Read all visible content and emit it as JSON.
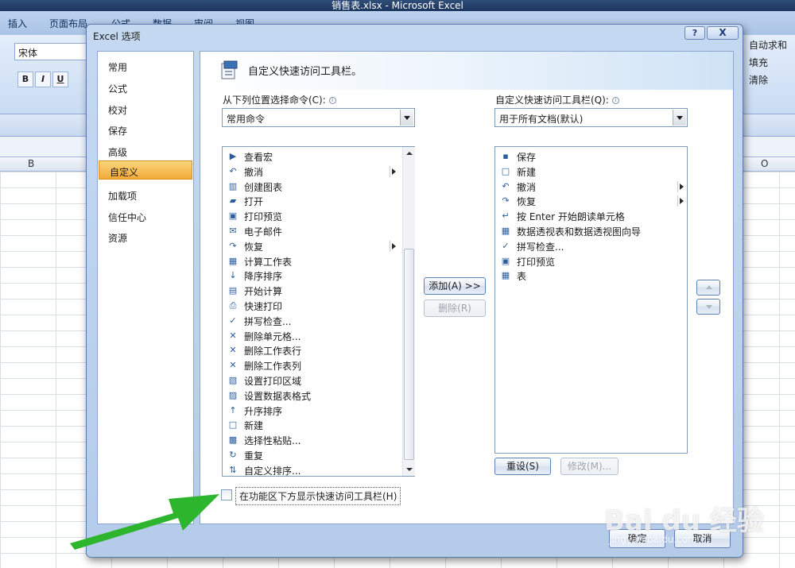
{
  "excel": {
    "title": "销售表.xlsx - Microsoft Excel",
    "tabs": [
      "插入",
      "页面布局",
      "公式",
      "数据",
      "审阅",
      "视图"
    ],
    "font_name": "宋体",
    "right_commands": [
      "自动求和",
      "填充",
      "清除"
    ],
    "columns": [
      "B",
      "O"
    ]
  },
  "dialog": {
    "title": "Excel 选项",
    "help_label": "?",
    "close_label": "X",
    "nav": [
      "常用",
      "公式",
      "校对",
      "保存",
      "高级",
      "自定义",
      "加载项",
      "信任中心",
      "资源"
    ],
    "selected_nav": "自定义",
    "header": "自定义快速访问工具栏。",
    "left_label": "从下列位置选择命令(C):",
    "left_combo": "常用命令",
    "right_label": "自定义快速访问工具栏(Q):",
    "right_combo": "用于所有文档(默认)",
    "commands": [
      {
        "label": "查看宏",
        "icon": "play-icon",
        "glyph": "▶",
        "submenu": false
      },
      {
        "label": "撤消",
        "icon": "undo-icon",
        "glyph": "↶",
        "submenu": true
      },
      {
        "label": "创建图表",
        "icon": "chart-icon",
        "glyph": "▥",
        "submenu": false
      },
      {
        "label": "打开",
        "icon": "folder-icon",
        "glyph": "▰",
        "submenu": false
      },
      {
        "label": "打印预览",
        "icon": "print-preview-icon",
        "glyph": "▣",
        "submenu": false
      },
      {
        "label": "电子邮件",
        "icon": "email-icon",
        "glyph": "✉",
        "submenu": false
      },
      {
        "label": "恢复",
        "icon": "redo-icon",
        "glyph": "↷",
        "submenu": true
      },
      {
        "label": "计算工作表",
        "icon": "calculator-icon",
        "glyph": "▦",
        "submenu": false
      },
      {
        "label": "降序排序",
        "icon": "sort-desc-icon",
        "glyph": "↓",
        "submenu": false
      },
      {
        "label": "开始计算",
        "icon": "calculate-icon",
        "glyph": "▤",
        "submenu": false
      },
      {
        "label": "快速打印",
        "icon": "printer-icon",
        "glyph": "⎙",
        "submenu": false
      },
      {
        "label": "拼写检查...",
        "icon": "spell-check-icon",
        "glyph": "✓",
        "submenu": false
      },
      {
        "label": "删除单元格...",
        "icon": "delete-cells-icon",
        "glyph": "✕",
        "submenu": false
      },
      {
        "label": "删除工作表行",
        "icon": "delete-rows-icon",
        "glyph": "✕",
        "submenu": false
      },
      {
        "label": "删除工作表列",
        "icon": "delete-columns-icon",
        "glyph": "✕",
        "submenu": false
      },
      {
        "label": "设置打印区域",
        "icon": "print-area-icon",
        "glyph": "▧",
        "submenu": false
      },
      {
        "label": "设置数据表格式",
        "icon": "table-format-icon",
        "glyph": "▨",
        "submenu": false
      },
      {
        "label": "升序排序",
        "icon": "sort-asc-icon",
        "glyph": "↑",
        "submenu": false
      },
      {
        "label": "新建",
        "icon": "new-document-icon",
        "glyph": "□",
        "submenu": false
      },
      {
        "label": "选择性粘贴...",
        "icon": "paste-special-icon",
        "glyph": "▩",
        "submenu": false
      },
      {
        "label": "重复",
        "icon": "repeat-icon",
        "glyph": "↻",
        "submenu": false
      },
      {
        "label": "自定义排序...",
        "icon": "custom-sort-icon",
        "glyph": "⇅",
        "submenu": false
      }
    ],
    "toolbar_items": [
      {
        "label": "保存",
        "icon": "save-icon",
        "glyph": "▪",
        "submenu": false
      },
      {
        "label": "新建",
        "icon": "new-document-icon",
        "glyph": "□",
        "submenu": false
      },
      {
        "label": "撤消",
        "icon": "undo-icon",
        "glyph": "↶",
        "submenu": true
      },
      {
        "label": "恢复",
        "icon": "redo-icon",
        "glyph": "↷",
        "submenu": true
      },
      {
        "label": "按 Enter 开始朗读单元格",
        "icon": "speak-cells-icon",
        "glyph": "↵",
        "submenu": false
      },
      {
        "label": "数据透视表和数据透视图向导",
        "icon": "pivot-wizard-icon",
        "glyph": "▦",
        "submenu": false
      },
      {
        "label": "拼写检查...",
        "icon": "spell-check-icon",
        "glyph": "✓",
        "submenu": false
      },
      {
        "label": "打印预览",
        "icon": "print-preview-icon",
        "glyph": "▣",
        "submenu": false
      },
      {
        "label": "表",
        "icon": "table-icon",
        "glyph": "▦",
        "submenu": false
      }
    ],
    "add_button": "添加(A) >>",
    "remove_button": "删除(R)",
    "reset_button": "重设(S)",
    "modify_button": "修改(M)...",
    "checkbox_label": "在功能区下方显示快速访问工具栏(H)",
    "checkbox_checked": false,
    "ok_button": "确定",
    "cancel_button": "取消"
  },
  "watermark": {
    "brand": "Bai du 经验",
    "url": "jingyan.baidu.com"
  },
  "colors": {
    "accent_selected": "#f3a93a",
    "annotation_arrow": "#2db52d",
    "dialog_frame": "#b4cbea"
  }
}
